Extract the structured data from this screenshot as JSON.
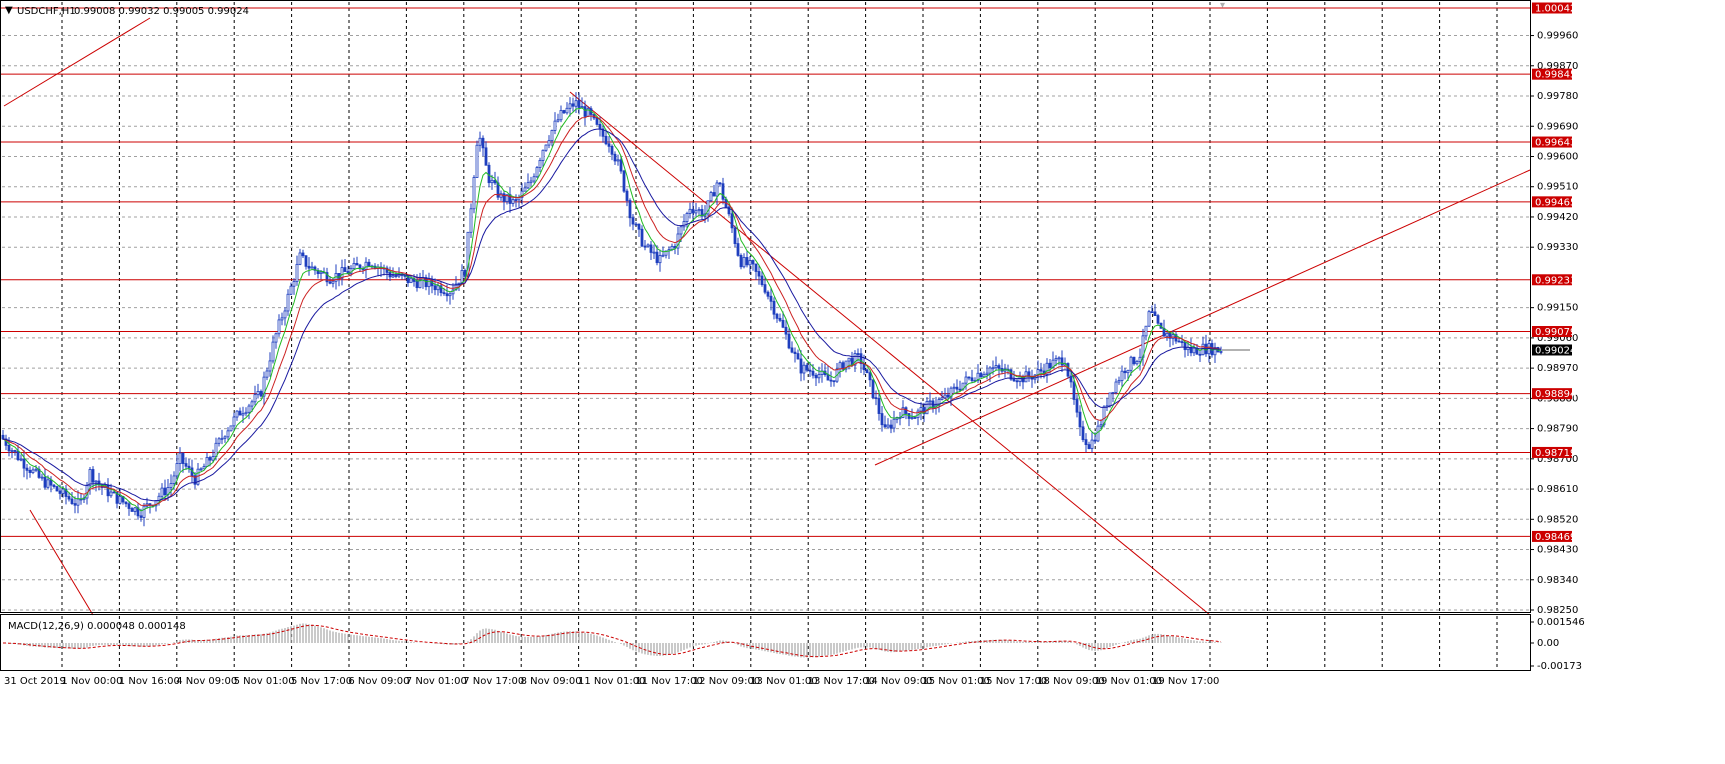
{
  "header": {
    "symbol": "USDCHF,H1",
    "ohlc": "0.99008 0.99032 0.99005 0.99024"
  },
  "indicator": {
    "label": "MACD(12,26,9) 0.000048 0.000148",
    "axis_labels": [
      "0.001546",
      "0.00",
      "-0.00173"
    ]
  },
  "colors": {
    "candles": "#1f3fbf",
    "ma_fast": "#22bb22",
    "ma_mid": "#cc2222",
    "ma_slow": "#1a1aa0",
    "levels": "#cc0000",
    "grid": "#a0a0a0",
    "macd": "#b4b4b4",
    "signal": "#cc0000",
    "price_tag": "#000000"
  },
  "chart_data": {
    "type": "candlestick",
    "symbol": "USDCHF",
    "timeframe": "H1",
    "y_range": [
      0.9825,
      1.00042
    ],
    "y_ticks": [
      "0.99960",
      "0.99870",
      "0.99780",
      "0.99690",
      "0.99600",
      "0.99510",
      "0.99420",
      "0.99330",
      "0.99150",
      "0.99060",
      "0.98970",
      "0.98880",
      "0.98790",
      "0.98700",
      "0.98610",
      "0.98520",
      "0.98430",
      "0.98340",
      "0.98250"
    ],
    "x_labels": [
      "31 Oct 2019",
      "1 Nov 00:00",
      "1 Nov 16:00",
      "4 Nov 09:00",
      "5 Nov 01:00",
      "5 Nov 17:00",
      "6 Nov 09:00",
      "7 Nov 01:00",
      "7 Nov 17:00",
      "8 Nov 09:00",
      "11 Nov 01:00",
      "11 Nov 17:00",
      "12 Nov 09:00",
      "13 Nov 01:00",
      "13 Nov 17:00",
      "14 Nov 09:00",
      "15 Nov 01:00",
      "15 Nov 17:00",
      "18 Nov 09:00",
      "19 Nov 01:00",
      "19 Nov 17:00"
    ],
    "price_levels": [
      "1.00042",
      "0.99845",
      "0.99643",
      "0.99465",
      "0.99233",
      "0.99079",
      "0.98894",
      "0.98719",
      "0.98469"
    ],
    "current_price": "0.99024",
    "close_path": [
      [
        0,
        0.9877
      ],
      [
        20,
        0.987
      ],
      [
        40,
        0.9864
      ],
      [
        60,
        0.986
      ],
      [
        80,
        0.9856
      ],
      [
        90,
        0.9866
      ],
      [
        100,
        0.9862
      ],
      [
        118,
        0.9858
      ],
      [
        130,
        0.9856
      ],
      [
        140,
        0.9854
      ],
      [
        155,
        0.9858
      ],
      [
        170,
        0.9862
      ],
      [
        180,
        0.987
      ],
      [
        195,
        0.9864
      ],
      [
        210,
        0.987
      ],
      [
        225,
        0.9878
      ],
      [
        240,
        0.9884
      ],
      [
        260,
        0.9889
      ],
      [
        275,
        0.9906
      ],
      [
        290,
        0.992
      ],
      [
        300,
        0.993
      ],
      [
        310,
        0.9927
      ],
      [
        330,
        0.9924
      ],
      [
        350,
        0.9926
      ],
      [
        370,
        0.9929
      ],
      [
        390,
        0.9925
      ],
      [
        410,
        0.9923
      ],
      [
        430,
        0.9922
      ],
      [
        450,
        0.992
      ],
      [
        465,
        0.9926
      ],
      [
        478,
        0.9968
      ],
      [
        488,
        0.9954
      ],
      [
        500,
        0.9948
      ],
      [
        515,
        0.9946
      ],
      [
        530,
        0.9952
      ],
      [
        545,
        0.9964
      ],
      [
        560,
        0.9972
      ],
      [
        575,
        0.9976
      ],
      [
        590,
        0.9972
      ],
      [
        600,
        0.9967
      ],
      [
        610,
        0.9964
      ],
      [
        620,
        0.9956
      ],
      [
        632,
        0.9941
      ],
      [
        645,
        0.9933
      ],
      [
        660,
        0.9929
      ],
      [
        675,
        0.9934
      ],
      [
        690,
        0.9945
      ],
      [
        705,
        0.9943
      ],
      [
        718,
        0.9953
      ],
      [
        730,
        0.9941
      ],
      [
        740,
        0.9929
      ],
      [
        752,
        0.9927
      ],
      [
        765,
        0.9921
      ],
      [
        778,
        0.9912
      ],
      [
        790,
        0.9904
      ],
      [
        800,
        0.9897
      ],
      [
        815,
        0.9896
      ],
      [
        830,
        0.9893
      ],
      [
        845,
        0.9899
      ],
      [
        860,
        0.99
      ],
      [
        875,
        0.9888
      ],
      [
        885,
        0.9878
      ],
      [
        900,
        0.9884
      ],
      [
        915,
        0.9883
      ],
      [
        930,
        0.9886
      ],
      [
        945,
        0.9888
      ],
      [
        960,
        0.9892
      ],
      [
        975,
        0.9895
      ],
      [
        990,
        0.9897
      ],
      [
        1005,
        0.9896
      ],
      [
        1020,
        0.9894
      ],
      [
        1035,
        0.9895
      ],
      [
        1050,
        0.9898
      ],
      [
        1065,
        0.99
      ],
      [
        1080,
        0.9878
      ],
      [
        1090,
        0.9874
      ],
      [
        1100,
        0.988
      ],
      [
        1110,
        0.989
      ],
      [
        1125,
        0.9897
      ],
      [
        1140,
        0.9901
      ],
      [
        1150,
        0.9914
      ],
      [
        1160,
        0.9908
      ],
      [
        1175,
        0.9906
      ],
      [
        1190,
        0.9902
      ],
      [
        1205,
        0.9903
      ],
      [
        1220,
        0.99024
      ]
    ]
  }
}
